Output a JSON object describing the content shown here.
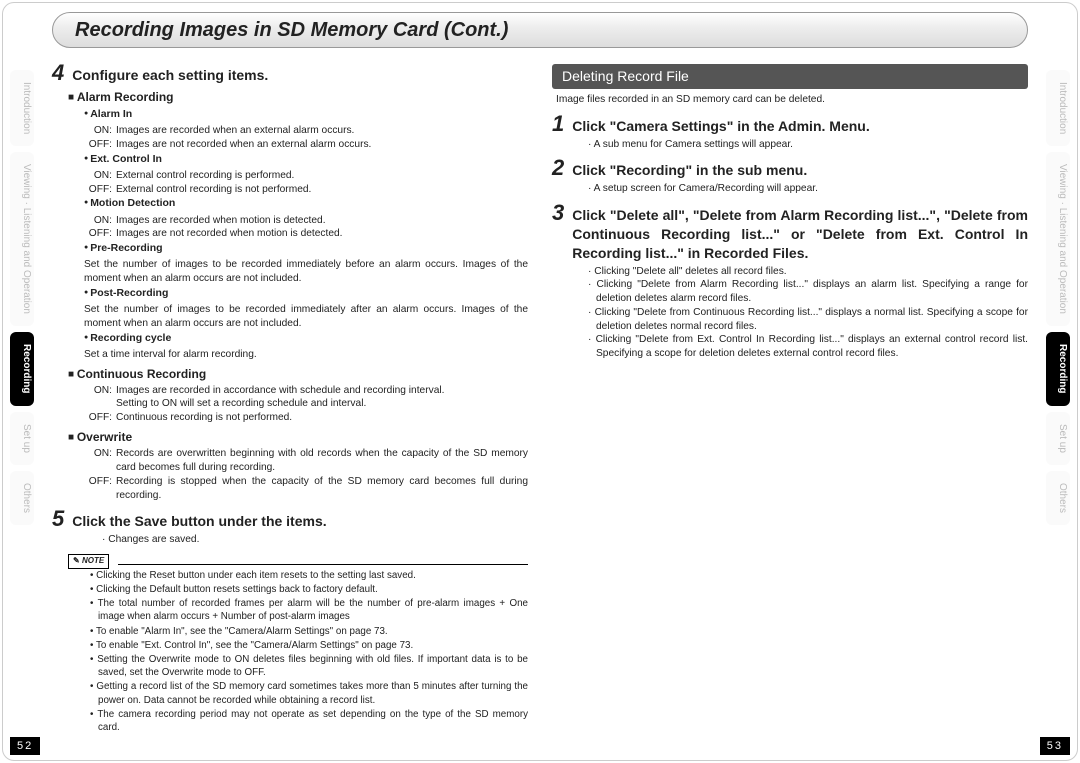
{
  "title": "Recording Images in SD Memory Card (Cont.)",
  "side_tabs": [
    "Introduction",
    "Viewing · Listening and Operation",
    "Recording",
    "Set up",
    "Others"
  ],
  "page_left": "52",
  "page_right": "53",
  "left": {
    "step4": {
      "num": "4",
      "text": "Configure each setting items."
    },
    "alarm_h": "Alarm Recording",
    "alarm_in": {
      "h": "Alarm In",
      "on": "Images are recorded when an external alarm occurs.",
      "off": "Images are not recorded when an external alarm occurs."
    },
    "ext_ctrl": {
      "h": "Ext. Control In",
      "on": "External control recording is performed.",
      "off": "External control recording is not performed."
    },
    "motion": {
      "h": "Motion Detection",
      "on": "Images are recorded when motion is detected.",
      "off": "Images are not recorded when motion is detected."
    },
    "pre_rec": {
      "h": "Pre-Recording",
      "d": "Set the number of images to be recorded immediately before an alarm occurs. Images of the moment when an alarm occurs are not included."
    },
    "post_rec": {
      "h": "Post-Recording",
      "d": "Set the number of images to be recorded immediately after an alarm occurs. Images of the moment when an alarm occurs are not included."
    },
    "rec_cycle": {
      "h": "Recording cycle",
      "d": "Set a time interval for alarm recording."
    },
    "cont_h": "Continuous Recording",
    "cont": {
      "on": "Images are recorded in accordance with schedule and recording interval.",
      "on2": "Setting to ON will set a recording schedule and interval.",
      "off": "Continuous recording is not performed."
    },
    "over_h": "Overwrite",
    "over": {
      "on": "Records are overwritten beginning with old records when the capacity of the SD memory card becomes full during recording.",
      "off": "Recording is stopped when the capacity of the SD memory card becomes full during recording."
    },
    "step5": {
      "num": "5",
      "text": "Click the Save button under the items."
    },
    "step5_d": "Changes are saved.",
    "note_label": "NOTE",
    "notes": [
      "Clicking the Reset button under each item resets to the setting last saved.",
      "Clicking the Default button resets settings back to factory default.",
      "The total number of recorded frames per alarm will be the number of pre-alarm images + One image when alarm occurs + Number of post-alarm images",
      "To enable \"Alarm In\", see the \"Camera/Alarm Settings\" on page 73.",
      "To enable \"Ext. Control In\", see the \"Camera/Alarm Settings\" on page 73.",
      "Setting the Overwrite mode to ON deletes files beginning with old files. If important data is to be saved, set the Overwrite mode to OFF.",
      "Getting a record list of the SD memory card sometimes takes more than 5 minutes after turning the power on. Data cannot be recorded while obtaining a record list.",
      "The camera recording period may not operate as set depending on the type of the SD memory card."
    ]
  },
  "right": {
    "header": "Deleting Record File",
    "intro": "Image files recorded in an SD memory card can be deleted.",
    "s1": {
      "num": "1",
      "text": "Click \"Camera Settings\" in the Admin. Menu.",
      "d": "A sub menu for Camera settings will appear."
    },
    "s2": {
      "num": "2",
      "text": "Click \"Recording\" in the sub menu.",
      "d": "A setup screen for Camera/Recording will appear."
    },
    "s3": {
      "num": "3",
      "text": "Click \"Delete all\", \"Delete from Alarm Recording list...\", \"Delete from Continuous Recording list...\" or \"Delete from Ext. Control In Recording list...\" in Recorded Files."
    },
    "s3_subs": [
      "Clicking \"Delete all\" deletes all record files.",
      "Clicking \"Delete from Alarm Recording list...\" displays an alarm list. Specifying a range for deletion deletes alarm record files.",
      "Clicking \"Delete from Continuous Recording list...\" displays a normal list. Specifying a scope for deletion deletes normal record files.",
      "Clicking \"Delete from Ext. Control In Recording list...\" displays an external control record list. Specifying a scope for deletion deletes external control record files."
    ]
  }
}
